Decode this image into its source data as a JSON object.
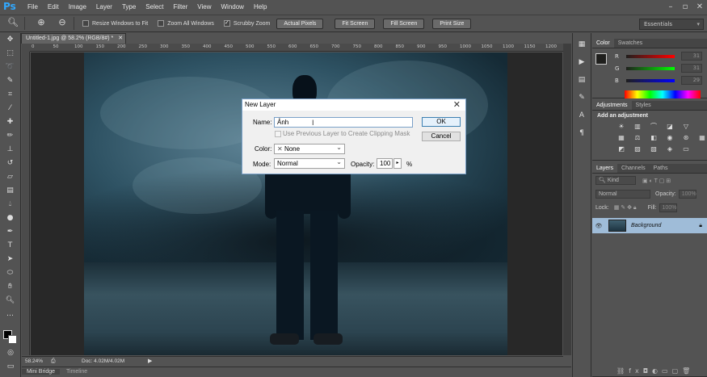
{
  "app": {
    "logo": "Ps"
  },
  "menu": [
    "File",
    "Edit",
    "Image",
    "Layer",
    "Type",
    "Select",
    "Filter",
    "View",
    "Window",
    "Help"
  ],
  "options_bar": {
    "zoom_value": "",
    "checkboxes": [
      {
        "label": "Resize Windows to Fit",
        "checked": false
      },
      {
        "label": "Zoom All Windows",
        "checked": false
      },
      {
        "label": "Scrubby Zoom",
        "checked": true
      }
    ],
    "buttons": [
      "Actual Pixels",
      "Fit Screen",
      "Fill Screen",
      "Print Size"
    ],
    "workspace": "Essentials"
  },
  "document": {
    "tab_title": "Untitled-1.jpg @ 58.2% (RGB/8#) *",
    "ruler_ticks": [
      "0",
      "50",
      "100",
      "150",
      "200",
      "250",
      "300",
      "350",
      "400",
      "450",
      "500",
      "550",
      "600",
      "650",
      "700",
      "750",
      "800",
      "850",
      "900",
      "950",
      "1000",
      "1050",
      "1100",
      "1150",
      "1200"
    ],
    "zoom": "58.24%",
    "doc_size": "Doc: 4.02M/4.02M"
  },
  "bottom_tabs": [
    "Mini Bridge",
    "Timeline"
  ],
  "color_panel": {
    "tabs": [
      "Color",
      "Swatches"
    ],
    "channels": [
      {
        "label": "R",
        "value": "31"
      },
      {
        "label": "G",
        "value": "31"
      },
      {
        "label": "B",
        "value": "29"
      }
    ]
  },
  "adjustments_panel": {
    "tabs": [
      "Adjustments",
      "Styles"
    ],
    "heading": "Add an adjustment"
  },
  "layers_panel": {
    "tabs": [
      "Layers",
      "Channels",
      "Paths"
    ],
    "filter": "Kind",
    "blend_mode": "Normal",
    "opacity_label": "Opacity:",
    "opacity_value": "100%",
    "lock_label": "Lock:",
    "fill_label": "Fill:",
    "fill_value": "100%",
    "layers": [
      {
        "name": "Background",
        "visible": true
      }
    ]
  },
  "dialog": {
    "title": "New Layer",
    "name_label": "Name:",
    "name_value": "Ảnh",
    "clip_label": "Use Previous Layer to Create Clipping Mask",
    "color_label": "Color:",
    "color_value": "None",
    "mode_label": "Mode:",
    "mode_value": "Normal",
    "opacity_label": "Opacity:",
    "opacity_value": "100",
    "percent": "%",
    "ok": "OK",
    "cancel": "Cancel"
  }
}
